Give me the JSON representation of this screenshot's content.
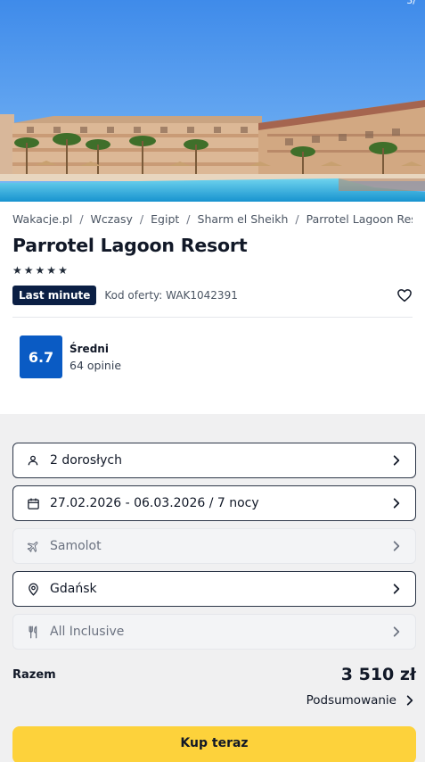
{
  "gallery": {
    "counter": "3/",
    "image_alt": "Parrotel Lagoon Resort pool"
  },
  "breadcrumb": [
    "Wakacje.pl",
    "Wczasy",
    "Egipt",
    "Sharm el Sheikh",
    "Parrotel Lagoon Resort"
  ],
  "hotel": {
    "name": "Parrotel Lagoon Resort",
    "stars": 5,
    "badge": "Last minute",
    "offer_code": "Kod oferty: WAK1042391"
  },
  "rating": {
    "score": "6.7",
    "label": "Średni",
    "count": "64 opinie",
    "color": "#0a5bc4"
  },
  "options": {
    "travelers": "2 dorosłych",
    "dates": "27.02.2026 - 06.03.2026 / 7 nocy",
    "transport": "Samolot",
    "departure": "Gdańsk",
    "board": "All Inclusive"
  },
  "total": {
    "label": "Razem",
    "price": "3 510 zł",
    "summary": "Podsumowanie"
  },
  "cta": {
    "label": "Kup teraz",
    "color": "#fdd23b"
  }
}
